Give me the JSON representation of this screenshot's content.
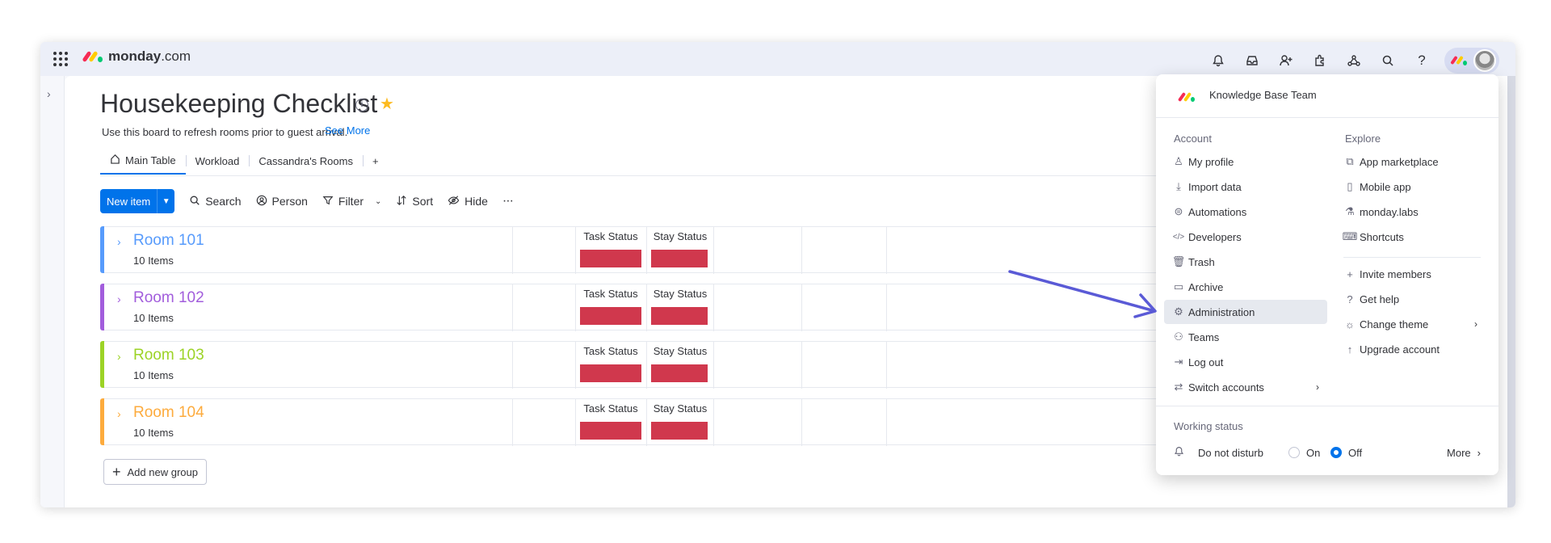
{
  "brand": {
    "name": "monday",
    "suffix": ".com",
    "colors": [
      "#f62b54",
      "#ffcc00",
      "#00ca72"
    ]
  },
  "topbar": {
    "icons": [
      "bell-icon",
      "inbox-icon",
      "invite-user-icon",
      "apps-icon",
      "integrations-icon",
      "search-icon",
      "help-icon"
    ]
  },
  "board": {
    "title": "Housekeeping Checklist",
    "description": "Use this board to refresh rooms prior to guest arrival.",
    "see_more": "See More",
    "tabs": [
      {
        "label": "Main Table",
        "active": true
      },
      {
        "label": "Workload"
      },
      {
        "label": "Cassandra's Rooms"
      }
    ],
    "add_tab": "+"
  },
  "toolbar": {
    "new_item": "New item",
    "search": "Search",
    "person": "Person",
    "filter": "Filter",
    "sort": "Sort",
    "hide": "Hide",
    "more": "···"
  },
  "groups": [
    {
      "name": "Room 101",
      "count": "10 Items",
      "color": "#579bfc",
      "col1": "Task Status",
      "col2": "Stay Status"
    },
    {
      "name": "Room 102",
      "count": "10 Items",
      "color": "#a25ddc",
      "col1": "Task Status",
      "col2": "Stay Status"
    },
    {
      "name": "Room 103",
      "count": "10 Items",
      "color": "#9cd326",
      "col1": "Task Status",
      "col2": "Stay Status"
    },
    {
      "name": "Room 104",
      "count": "10 Items",
      "color": "#fdab3d",
      "col1": "Task Status",
      "col2": "Stay Status"
    }
  ],
  "status_color": "#d0384d",
  "add_group": "Add new group",
  "menu": {
    "team": "Knowledge Base Team",
    "account_label": "Account",
    "explore_label": "Explore",
    "account_items": [
      "My profile",
      "Import data",
      "Automations",
      "Developers",
      "Trash",
      "Archive",
      "Administration",
      "Teams",
      "Log out",
      "Switch accounts"
    ],
    "explore_items": [
      "App marketplace",
      "Mobile app",
      "monday.labs",
      "Shortcuts"
    ],
    "explore_items2": [
      "Invite members",
      "Get help",
      "Change theme",
      "Upgrade account"
    ],
    "working_status": "Working status",
    "dnd": "Do not disturb",
    "on": "On",
    "off": "Off",
    "more": "More",
    "highlighted": "Administration"
  },
  "annotation_color": "#5a5ad6"
}
